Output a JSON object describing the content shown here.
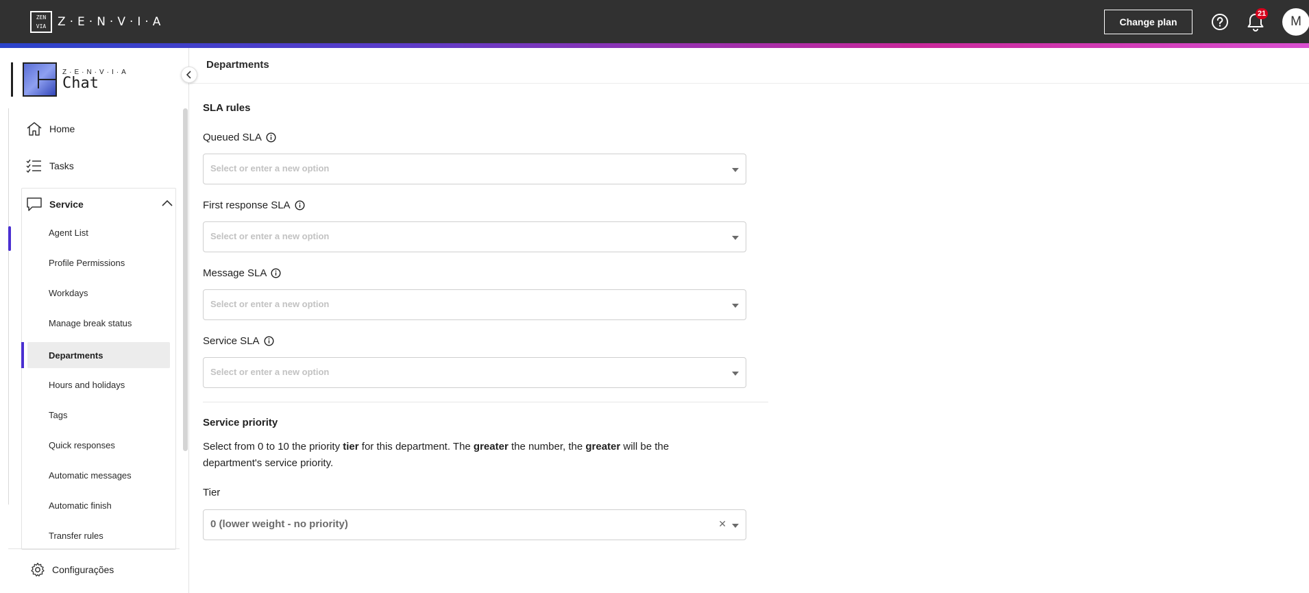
{
  "topbar": {
    "brand_text": "Z·E·N·V·I·A",
    "change_plan_label": "Change plan",
    "notifications_count": "21",
    "avatar_initial": "M"
  },
  "sidebar": {
    "logo_small": "Z·E·N·V·I·A",
    "logo_big": "Chat",
    "home_label": "Home",
    "tasks_label": "Tasks",
    "service_label": "Service",
    "service_items": [
      "Agent List",
      "Profile Permissions",
      "Workdays",
      "Manage break status",
      "Departments",
      "Hours and holidays",
      "Tags",
      "Quick responses",
      "Automatic messages",
      "Automatic finish",
      "Transfer rules"
    ],
    "active_item": "Departments",
    "settings_label": "Configurações"
  },
  "main": {
    "page_title": "Departments",
    "sla_section_title": "SLA rules",
    "fields": [
      {
        "label": "Queued SLA",
        "placeholder": "Select or enter a new option"
      },
      {
        "label": "First response SLA",
        "placeholder": "Select or enter a new option"
      },
      {
        "label": "Message SLA",
        "placeholder": "Select or enter a new option"
      },
      {
        "label": "Service SLA",
        "placeholder": "Select or enter a new option"
      }
    ],
    "priority_section_title": "Service priority",
    "priority_description": {
      "part1": "Select from 0 to 10 the priority ",
      "bold1": "tier",
      "part2": " for this department. The ",
      "bold2": "greater",
      "part3": " the number, the ",
      "bold3": "greater",
      "part4": " will be the department's service priority."
    },
    "tier_label": "Tier",
    "tier_value": "0 (lower weight - no priority)"
  },
  "colors": {
    "topbar": "#313131",
    "accent": "#4a2fd1",
    "badge": "#d6001c"
  }
}
